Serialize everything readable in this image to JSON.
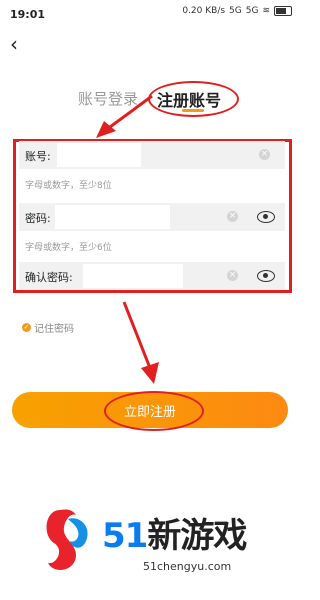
{
  "status_bar": {
    "time": "19:01",
    "speed": "0.20 KB/s",
    "net1": "5G",
    "net2": "5G"
  },
  "tabs": {
    "login": "账号登录",
    "register": "注册账号"
  },
  "form": {
    "account_label": "账号:",
    "account_hint": "字母或数字，至少8位",
    "password_label": "密码:",
    "password_hint": "字母或数字，至少6位",
    "confirm_label": "确认密码:"
  },
  "remember_label": "记住密码",
  "register_button": "立即注册",
  "watermark": {
    "brand_num": "51",
    "brand_text": "新游戏",
    "domain": "51chengyu.com"
  },
  "colors": {
    "accent": "#f39a1d",
    "annotation": "#e02020"
  }
}
